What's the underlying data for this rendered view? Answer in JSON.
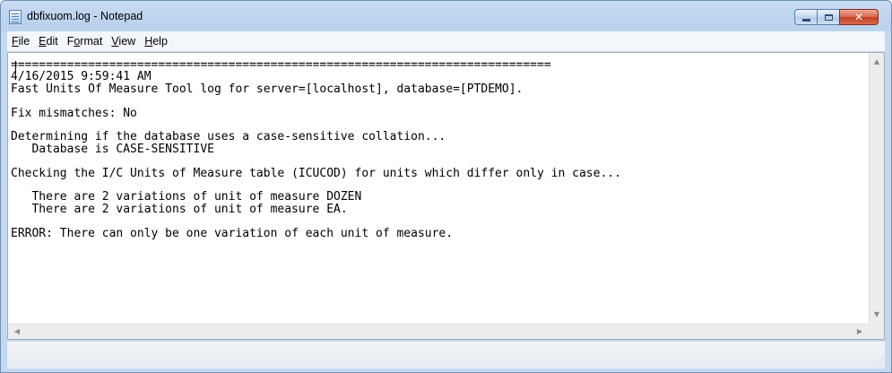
{
  "window": {
    "title": "dbfixuom.log - Notepad",
    "app_icon": "notepad-icon",
    "minimize_label": "",
    "maximize_label": "",
    "close_label": "✕"
  },
  "menu": {
    "file": "File",
    "edit": "Edit",
    "format": "Format",
    "view": "View",
    "help": "Help"
  },
  "document": {
    "content": "=============================================================================\n4/16/2015 9:59:41 AM\nFast Units Of Measure Tool log for server=[localhost], database=[PTDEMO].\n\nFix mismatches: No\n\nDetermining if the database uses a case-sensitive collation...\n   Database is CASE-SENSITIVE\n\nChecking the I/C Units of Measure table (ICUCOD) for units which differ only in case...\n\n   There are 2 variations of unit of measure DOZEN\n   There are 2 variations of unit of measure EA.\n\nERROR: There can only be one variation of each unit of measure."
  },
  "scrollbars": {
    "up_arrow": "▲",
    "down_arrow": "▼",
    "left_arrow": "◀",
    "right_arrow": "▶"
  },
  "colors": {
    "titlebar": "#b9d1ec",
    "close_button": "#c23f24",
    "menubar": "#f3f6fa"
  }
}
